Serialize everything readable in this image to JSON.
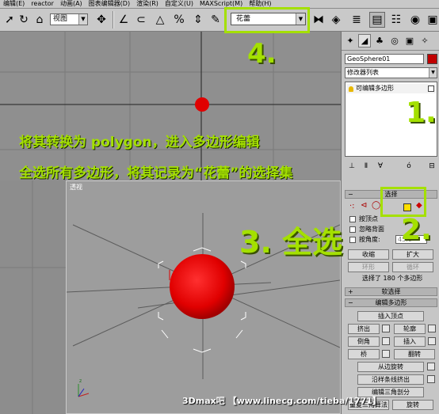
{
  "menu": {
    "items": [
      "编辑(E)",
      "reactor",
      "动画(A)",
      "图表编辑器(D)",
      "渲染(R)",
      "自定义(U)",
      "MAXScript(M)",
      "帮助(H)"
    ]
  },
  "toolbar": {
    "view_select": "视图",
    "selection_set": "花蕾",
    "icons": [
      "select-arrow-icon",
      "undo-icon",
      "select-object-icon",
      "select-move-icon",
      "rotate-icon",
      "scale-icon",
      "angle-snap-icon",
      "percent-snap-icon",
      "spinner-snap-icon",
      "mirror-icon",
      "align-icon",
      "layer-icon",
      "curve-editor-icon",
      "schematic-icon",
      "material-editor-icon",
      "render-icon"
    ]
  },
  "viewport_top": {
    "label": ""
  },
  "viewport_persp": {
    "label": "透视"
  },
  "command_panel": {
    "object_name": "GeoSphere01",
    "object_color": "#c00000",
    "modifier_list": "修改器列表",
    "stack_item": "可编辑多边形",
    "selection_rollout": {
      "title": "选择",
      "by_vertex": "按顶点",
      "ignore_backface": "忽略背面",
      "by_angle": "按角度:",
      "angle_value": "45.0",
      "shrink": "收缩",
      "grow": "扩大",
      "ring": "环形",
      "loop": "循环",
      "status": "选择了 180 个多边形"
    },
    "soft_selection_title": "软选择",
    "edit_polygons": {
      "title": "编辑多边形",
      "insert_vertex": "插入顶点",
      "extrude": "挤出",
      "outline": "轮廓",
      "bevel": "倒角",
      "inset": "插入",
      "bridge": "桥",
      "flip": "翻转",
      "hinge_from_edge": "从边旋转",
      "extrude_along_spline": "沿样条线挤出",
      "edit_triangulation": "编辑三角剖分",
      "retriangulate": "重复三角算法",
      "turn": "旋转"
    }
  },
  "overlays": {
    "step4": "4.",
    "step1": "1.",
    "step2": "2.",
    "step3": "3. 全选",
    "line1": "将其转换为 polygon，进入多边形编辑",
    "line2": "全选所有多边形，将其记录为“花蕾”的选择集",
    "watermark": "3Dmax吧 【www.linecg.com/tieba/1771】",
    "accent": "#a4e000",
    "sphere_color": "#e00000"
  }
}
